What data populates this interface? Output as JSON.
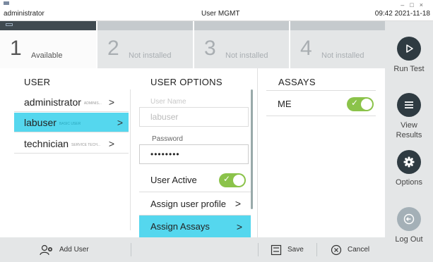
{
  "titlebar": {
    "user": "administrator",
    "title": "User MGMT",
    "datetime": "09:42 2021-11-18"
  },
  "slots": [
    {
      "number": "1",
      "status": "Available"
    },
    {
      "number": "2",
      "status": "Not installed"
    },
    {
      "number": "3",
      "status": "Not installed"
    },
    {
      "number": "4",
      "status": "Not installed"
    }
  ],
  "nav": {
    "run_test": "Run Test",
    "view_results": "View Results",
    "options": "Options",
    "log_out": "Log Out"
  },
  "user_panel": {
    "header": "USER",
    "users": [
      {
        "name": "administrator",
        "role": "ADMINIS..."
      },
      {
        "name": "labuser",
        "role": "BASIC USER"
      },
      {
        "name": "technician",
        "role": "SERVICE TECH..."
      }
    ]
  },
  "options_panel": {
    "header": "USER OPTIONS",
    "username_label": "User Name",
    "username_value": "labuser",
    "password_label": "Password",
    "password_value": "••••••••",
    "user_active_label": "User Active",
    "user_active": true,
    "assign_profile_label": "Assign user profile",
    "assign_assays_label": "Assign Assays"
  },
  "assays_panel": {
    "header": "ASSAYS",
    "items": [
      {
        "name": "ME",
        "enabled": true
      }
    ]
  },
  "bottombar": {
    "add_user": "Add User",
    "save": "Save",
    "cancel": "Cancel"
  },
  "colors": {
    "accent": "#55d7ee",
    "toggle_on": "#8bc34a",
    "dark": "#2f3b42"
  }
}
